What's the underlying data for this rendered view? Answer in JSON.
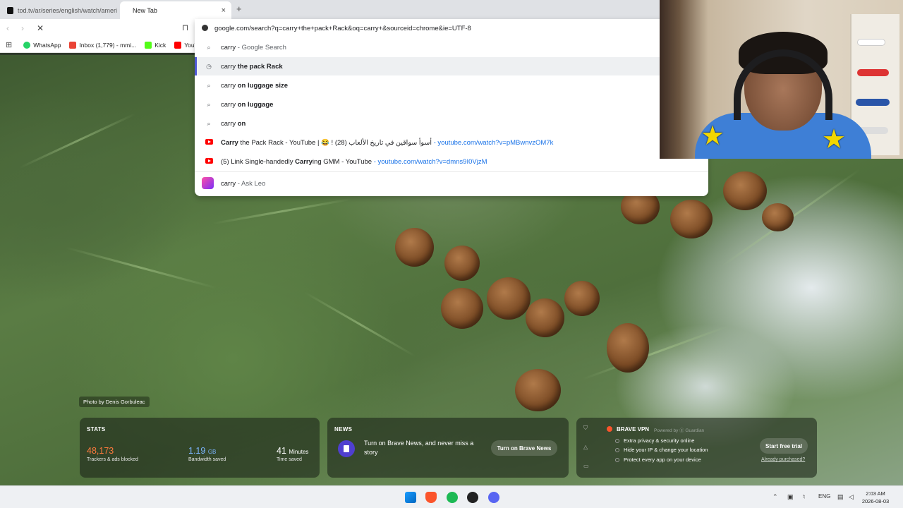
{
  "tabs": [
    {
      "label": "tod.tv/ar/series/english/watch/ameri"
    },
    {
      "label": "New Tab",
      "close": "×"
    }
  ],
  "new_tab_glyph": "+",
  "toolbar": {
    "back": "‹",
    "forward": "›",
    "reload": "✕",
    "bookmark": "⊓"
  },
  "omnibox": {
    "url": "google.com/search?q=carry+the+pack+Rack&oq=carry+&sourceid=chrome&ie=UTF-8",
    "suggestions": [
      {
        "type": "search",
        "bold": "carry",
        "rest": " - Google Search"
      },
      {
        "type": "history",
        "plain": "carry ",
        "bold": "the pack Rack"
      },
      {
        "type": "search",
        "plain": "carry ",
        "bold": "on luggage size"
      },
      {
        "type": "search",
        "plain": "carry ",
        "bold": "on luggage"
      },
      {
        "type": "search",
        "plain": "carry ",
        "bold": "on"
      },
      {
        "type": "youtube",
        "bold": "Carry",
        "rest": " the Pack Rack - YouTube | 😂 ! أسوأ سواقين في تاريخ الألعاب (28)",
        "url": " - youtube.com/watch?v=pMBwnvzOM7k"
      },
      {
        "type": "youtube",
        "plain": "(5) Link Single-handedly ",
        "bold": "Carry",
        "rest": "ing GMM - YouTube",
        "url": " - youtube.com/watch?v=dmns9I0VjzM"
      },
      {
        "type": "leo",
        "plain": "carry",
        "rest": " - Ask Leo"
      }
    ]
  },
  "bookmarks": [
    {
      "label": "WhatsApp",
      "icon": "whatsapp-icon",
      "color": "#25d366"
    },
    {
      "label": "Inbox (1,779) - mmi...",
      "icon": "gmail-icon",
      "color": "#ea4335"
    },
    {
      "label": "Kick",
      "icon": "kick-icon",
      "color": "#53fc18"
    },
    {
      "label": "YouT",
      "icon": "youtube-icon",
      "color": "#ff0000"
    }
  ],
  "credit": "Photo by Denis Gorbuleac",
  "stats": {
    "title": "STATS",
    "trackers": {
      "value": "48,173",
      "caption": "Trackers & ads blocked"
    },
    "bandwidth": {
      "value": "1.19",
      "unit": "GB",
      "caption": "Bandwidth saved"
    },
    "time": {
      "value": "41",
      "unit": "Minutes",
      "caption": "Time saved"
    }
  },
  "news": {
    "title": "NEWS",
    "text": "Turn on Brave News, and never miss a story",
    "button": "Turn on Brave News"
  },
  "vpn": {
    "title": "BRAVE VPN",
    "powered": "Powered by ⓖ Guardian",
    "features": [
      "Extra privacy & security online",
      "Hide your IP & change your location",
      "Protect every app on your device"
    ],
    "button": "Start free trial",
    "link": "Already purchased?"
  },
  "taskbar": {
    "lang": "ENG",
    "time": "2:03 AM",
    "date": "2026-08-03"
  },
  "colors": {
    "accent": "#4f58d6",
    "brave": "#fb542b",
    "stat_orange": "#ff7a3d",
    "stat_blue": "#7cb5ff"
  }
}
